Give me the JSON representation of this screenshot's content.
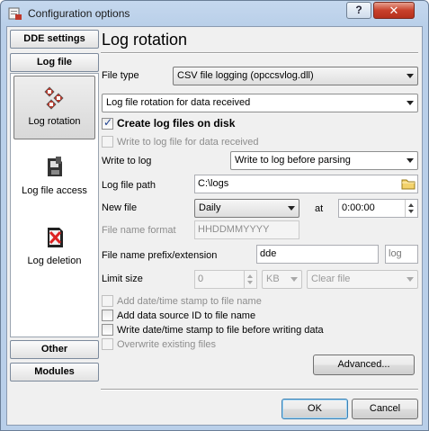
{
  "window": {
    "title": "Configuration options",
    "help_label": "?",
    "close_label": "✕"
  },
  "nav": {
    "top_buttons": [
      {
        "label": "DDE settings"
      },
      {
        "label": "Log file"
      }
    ],
    "items": [
      {
        "label": "Log rotation",
        "icon": "log-rotation-icon",
        "selected": true
      },
      {
        "label": "Log file access",
        "icon": "log-file-access-icon",
        "selected": false
      },
      {
        "label": "Log deletion",
        "icon": "log-deletion-icon",
        "selected": false
      }
    ],
    "bottom_buttons": [
      {
        "label": "Other"
      },
      {
        "label": "Modules"
      }
    ]
  },
  "page": {
    "title": "Log rotation"
  },
  "form": {
    "file_type_label": "File type",
    "file_type_value": "CSV file logging (opccsvlog.dll)",
    "rotation_value": "Log file rotation for data received",
    "create_logs_label": "Create log files on disk",
    "create_logs_checked": true,
    "write_received_label": "Write to log file for data received",
    "write_to_log_label": "Write to log",
    "write_to_log_value": "Write to log before parsing",
    "log_path_label": "Log file path",
    "log_path_value": "C:\\logs",
    "new_file_label": "New file",
    "new_file_value": "Daily",
    "at_label": "at",
    "at_value": "0:00:00",
    "name_format_label": "File name format",
    "name_format_value": "HHDDMMYYYY",
    "prefix_ext_label": "File name prefix/extension",
    "prefix_value": "dde",
    "ext_value": "log",
    "limit_label": "Limit size",
    "limit_value": "0",
    "limit_unit": "KB",
    "limit_action": "Clear file",
    "opt_add_datetime": "Add date/time stamp to file name",
    "opt_add_source": "Add data source ID to file name",
    "opt_write_stamp": "Write date/time stamp to file before writing data",
    "opt_overwrite": "Overwrite existing files",
    "advanced_label": "Advanced..."
  },
  "footer": {
    "ok_label": "OK",
    "cancel_label": "Cancel"
  }
}
